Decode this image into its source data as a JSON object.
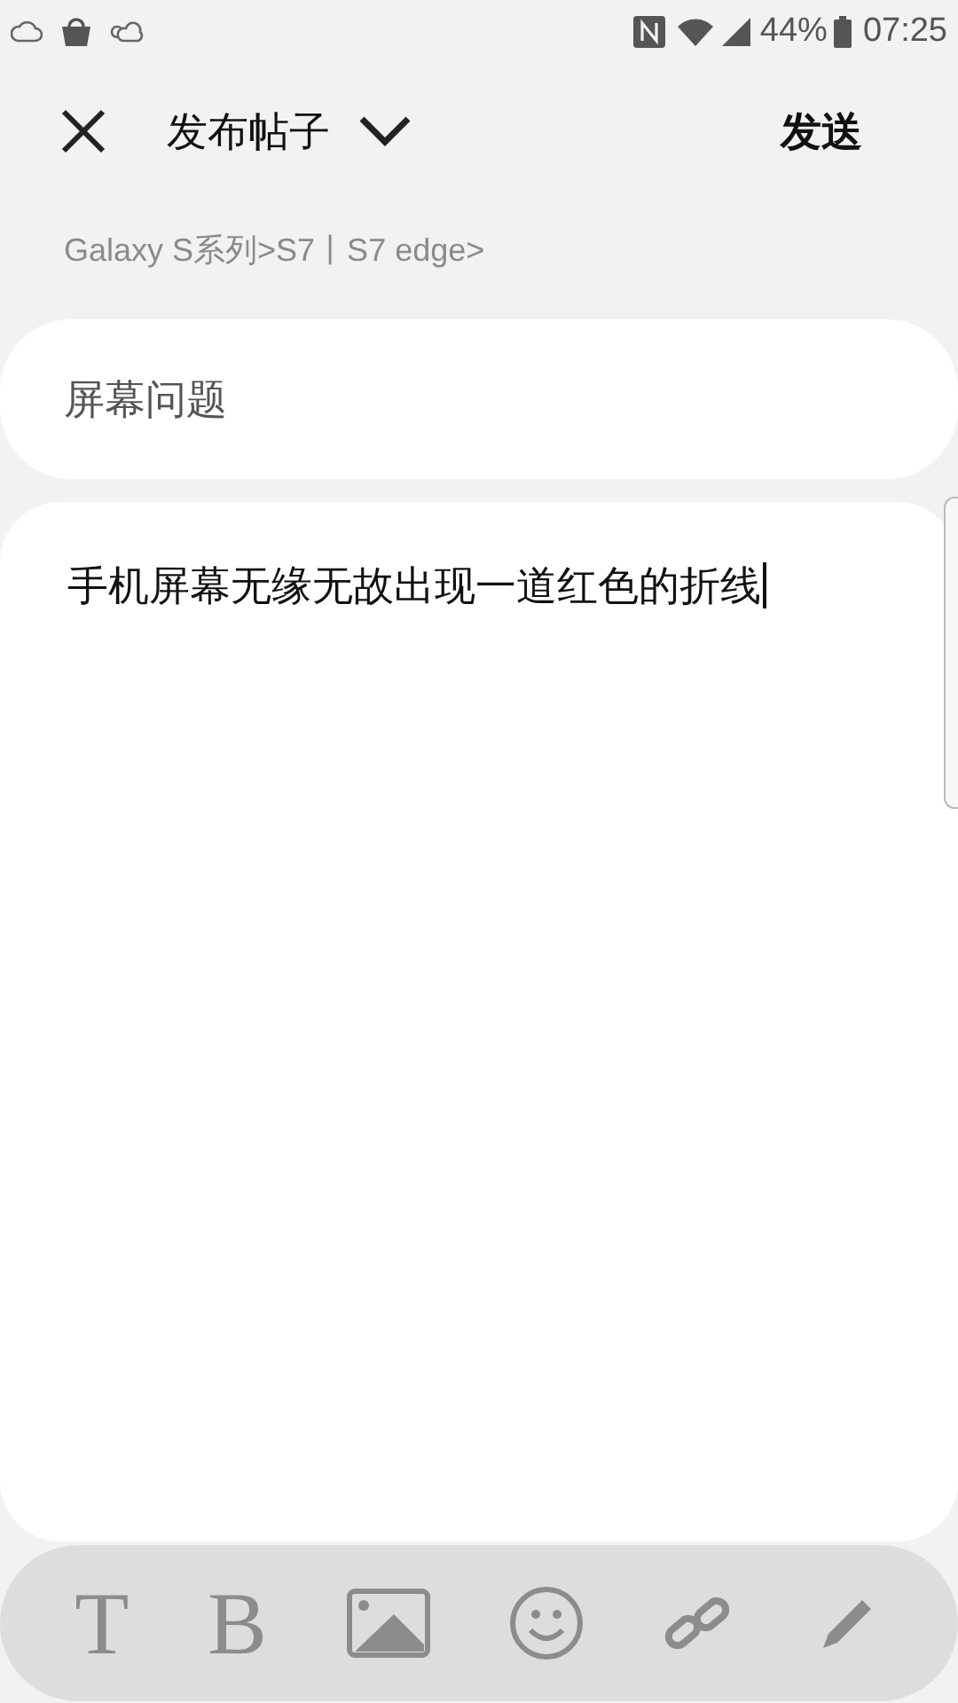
{
  "status_bar": {
    "battery": "44%",
    "time": "07:25"
  },
  "header": {
    "title": "发布帖子",
    "send": "发送"
  },
  "breadcrumb": "Galaxy S系列>S7丨S7 edge>",
  "subject": {
    "value": "屏幕问题"
  },
  "body": {
    "value": "手机屏幕无缘无故出现一道红色的折线"
  },
  "toolbar": [
    {
      "kind": "letter",
      "text": "T"
    },
    {
      "kind": "letter",
      "text": "B"
    },
    {
      "kind": "image"
    },
    {
      "kind": "emoji"
    },
    {
      "kind": "link"
    },
    {
      "kind": "pen"
    }
  ]
}
